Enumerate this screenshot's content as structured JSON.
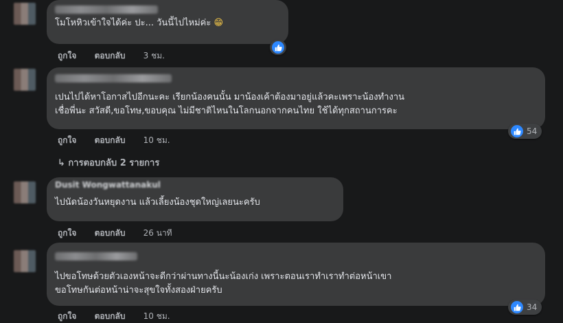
{
  "comments": [
    {
      "text_lines": [
        "โมโหหิวเข้าใจได้ค่ะ ปะ... วันนี้ไปไหม่ค่ะ"
      ],
      "emoji": "😁",
      "like_label": "ถูกใจ",
      "reply_label": "ตอบกลับ",
      "time": "3 ชม.",
      "reaction_count": ""
    },
    {
      "text_lines": [
        "เปนไปได้หาโอกาสไปอีกนะคะ เรียกน้องคนนั้น มาน้องเค้าต้องมาอยู่แล้วคะเพราะน้องทำงาน",
        "เชื่อพี่นะ สวัสดี,ขอโทษ,ขอบคุณ ไม่มีชาติไหนในโลกนอกจากคนไทย ใช้ได้ทุกสถานการคะ"
      ],
      "like_label": "ถูกใจ",
      "reply_label": "ตอบกลับ",
      "time": "10 ชม.",
      "reaction_count": "54",
      "replies_label": "↳ การตอบกลับ 2 รายการ"
    },
    {
      "name_partial": "Dusit Wongwattanakul",
      "text_lines": [
        "ไปนัดน้องวันหยุดงาน แล้วเลี้ยงน้องชุดใหญ่เลยนะครับ"
      ],
      "like_label": "ถูกใจ",
      "reply_label": "ตอบกลับ",
      "time": "26 นาที",
      "reaction_count": ""
    },
    {
      "text_lines": [
        "ไปขอโทษด้วยตัวเองหน้าจะดีกว่าผ่านทางนี้นะน้องเก่ง เพราะตอนเราทำเราทำต่อหน้าเขา",
        "ขอโทษกันต่อหน้าน่าจะสุขใจทั้งสองฝ่ายครับ"
      ],
      "like_label": "ถูกใจ",
      "reply_label": "ตอบกลับ",
      "time": "10 ชม.",
      "reaction_count": "34"
    }
  ],
  "colors": {
    "background": "#18191a",
    "bubble": "#3a3b3c",
    "like_blue": "#2d88ff",
    "text": "#e4e6eb",
    "muted": "#b0b3b8"
  },
  "icons": {
    "reaction": "like-thumb-icon",
    "reply_arrow": "reply-arrow-icon"
  }
}
